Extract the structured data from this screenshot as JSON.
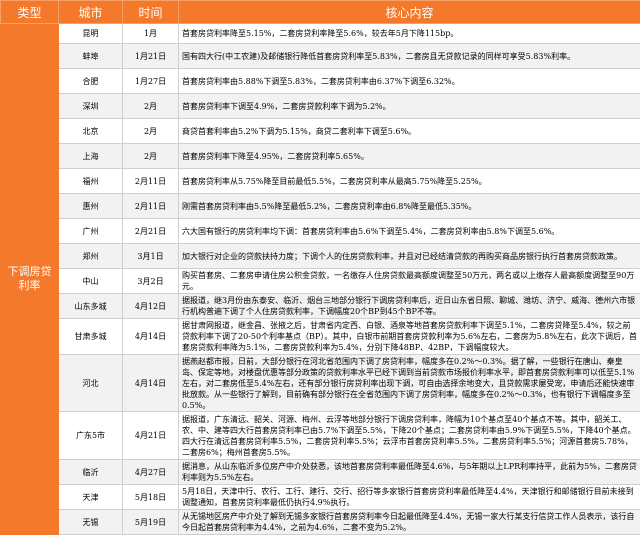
{
  "header": {
    "type": "类型",
    "city": "城市",
    "time": "时间",
    "content": "核心内容"
  },
  "type_label": "下调房贷利率",
  "rows": [
    {
      "city": "昆明",
      "time": "1月",
      "content": "首套房贷利率降至5.15%，二套房贷利率降至5.6%，较去年5月下降115bp。"
    },
    {
      "city": "蚌埠",
      "time": "1月21日",
      "content": "国有四大行(中工农建)及邮储银行降低首套房贷利率至5.83%，二套房且无贷款记录的同样可享受5.83%利率。"
    },
    {
      "city": "合肥",
      "time": "1月27日",
      "content": "首套房贷利率由5.88%下调至5.83%，二套房贷利率由6.37%下调至6.32%。"
    },
    {
      "city": "深圳",
      "time": "2月",
      "content": "首套房贷利率下调至4.9%，二套房贷款利率下调为5.2%。"
    },
    {
      "city": "北京",
      "time": "2月",
      "content": "商贷首套利率由5.2%下调为5.15%，商贷二套利率下调至5.6%。"
    },
    {
      "city": "上海",
      "time": "2月",
      "content": "首套房贷利率下降至4.95%，二套房贷利率5.65%。"
    },
    {
      "city": "福州",
      "time": "2月11日",
      "content": "首套房贷利率从5.75%降至目前最低5.5%，二套房贷利率从最高5.75%降至5.25%。"
    },
    {
      "city": "惠州",
      "time": "2月11日",
      "content": "刚需首套房贷利率由5.5%降至最低5.2%，二套房贷利率由6.8%降至最低5.35%。"
    },
    {
      "city": "广州",
      "time": "2月21日",
      "content": "六大国有银行的房贷利率均下调：首套房贷利率由5.6%下调至5.4%，二套房贷利率由5.8%下调至5.6%。"
    },
    {
      "city": "郑州",
      "time": "3月1日",
      "content": "加大银行对企业的贷款扶持力度；下调个人的住房贷款利率，并且对已经结清贷款的再购买商品房银行执行首套房贷款政策。"
    },
    {
      "city": "中山",
      "time": "3月2日",
      "content": "购买首套房、二套房申请住房公积金贷款，一名缴存人住房贷款最高额度调整至50万元，两名或以上缴存人最高额度调整至90万元。"
    },
    {
      "city": "山东多城",
      "time": "4月12日",
      "content": "据报道，继3月份由东泰安、临沂、烟台三地部分银行下调房贷利率后，近日山东省日照、聊城、潍坊、济宁、威海、德州六市银行机构普遍下调了个人住房贷款利率，下调幅度20个BP到45个BP不等。"
    },
    {
      "city": "甘肃多城",
      "time": "4月14日",
      "content": "据甘肃网报道，继金昌、张掖之后，甘肃省内定西、白银、酒泉等地首套房贷款利率下调至5.1%，二套房贷降至5.4%，较之前贷款利率下调了20-50个利率基点（BP）。其中，白银市前期首套房贷款利率为5.6%左右，二套房为5.8%左右，此次下调后，首套房贷款利率降为5.1%，二套房贷款利率为5.4%，分别下降48BP、42BP，下调幅度较大。"
    },
    {
      "city": "河北",
      "time": "4月14日",
      "content": "据燕赵都市报，日前，大部分银行在河北省范围内下调了房贷利率，幅度多在0.2%～0.3%。据了解，一些银行在唐山、秦皇岛、保定等地，对楼盘优惠等部分政策的贷款利率水平已经下调到当前贷款市场报价利率水平，即首套房贷款利率可以低至5.1%左右，对二套房低至5.4%左右，还有部分银行房贷利率出现下调，可自由选择余地变大，且贷款需求屡受宠，申请后还能快速审批放款。从一些银行了解到，目前确有部分银行在全省范围内下调了房贷利率，幅度多在0.2%～0.3%，也有银行下调幅度多至0.5%。"
    },
    {
      "city": "广东5市",
      "time": "4月21日",
      "content": "据报道，广东清远、韶关、河源、梅州、云浮等地部分银行下调房贷利率，降幅为10个基点至40个基点不等。其中，韶关工、农、中、建等四大行首套房贷利率已由5.7%下调至5.5%，下降20个基点；二套房贷利率由5.9%下调至5.5%，下降40个基点。四大行在清远首套房贷利率5.5%，二套房贷利率5.5%；云浮市首套房贷利率5.5%，二套房贷利率5.5%；河源首套房5.78%，二套房6%；梅州首套房5.5%。"
    },
    {
      "city": "临沂",
      "time": "4月27日",
      "content": "据消息，从山东临沂多位房产中介处获悉，该地首套房贷利率最低降至4.6%，与5年期以上LPR利率持平，此前为5%，二套房贷利率则为5.5%左右。"
    },
    {
      "city": "天津",
      "time": "5月18日",
      "content": "5月18日，天津中行、农行、工行、建行、交行、招行等多家银行首套房贷利率最低降至4.4%，天津银行和邮储银行目前未接到调整通知，首套房贷利率最低仍执行4.9%执行。"
    },
    {
      "city": "无锡",
      "time": "5月19日",
      "content": "从无锡地区房产中介处了解到无锡多家银行首套房贷利率今日起最低降至4.4%，无锡一家大行某支行信贷工作人员表示，该行自今日起首套房贷利率为4.4%，之前为4.6%，二套不变为5.2%。"
    }
  ]
}
